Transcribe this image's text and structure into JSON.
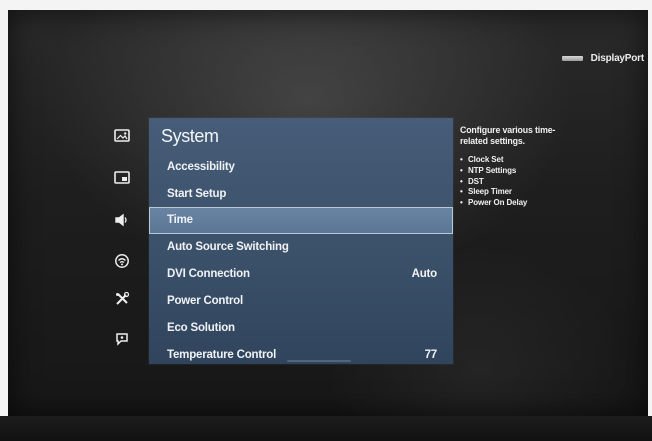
{
  "source_indicator": {
    "icon": "displayport-connector-icon",
    "label": "DisplayPort"
  },
  "categories": [
    {
      "icon": "picture-icon"
    },
    {
      "icon": "picture-in-picture-icon"
    },
    {
      "icon": "sound-icon"
    },
    {
      "icon": "network-icon"
    },
    {
      "icon": "tools-icon"
    },
    {
      "icon": "support-icon"
    }
  ],
  "menu": {
    "title": "System",
    "items": [
      {
        "label": "Accessibility",
        "value": ""
      },
      {
        "label": "Start Setup",
        "value": ""
      },
      {
        "label": "Time",
        "value": "",
        "selected": true
      },
      {
        "label": "Auto Source Switching",
        "value": ""
      },
      {
        "label": "DVI Connection",
        "value": "Auto"
      },
      {
        "label": "Power Control",
        "value": ""
      },
      {
        "label": "Eco Solution",
        "value": ""
      },
      {
        "label": "Temperature Control",
        "value": "77"
      }
    ]
  },
  "description": {
    "text": "Configure various time-related settings.",
    "bullets": [
      "Clock Set",
      "NTP Settings",
      "DST",
      "Sleep Timer",
      "Power On Delay"
    ]
  },
  "colors": {
    "panel": "#3b5169",
    "selected_row": "#5f7999",
    "selected_border": "#b9c8d7",
    "text": "#f0f2f5"
  }
}
